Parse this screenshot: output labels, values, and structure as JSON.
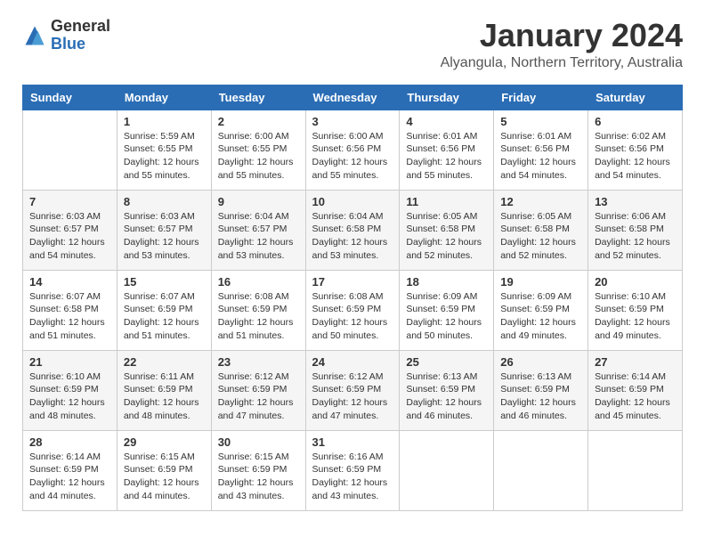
{
  "logo": {
    "general": "General",
    "blue": "Blue"
  },
  "header": {
    "month": "January 2024",
    "location": "Alyangula, Northern Territory, Australia"
  },
  "weekdays": [
    "Sunday",
    "Monday",
    "Tuesday",
    "Wednesday",
    "Thursday",
    "Friday",
    "Saturday"
  ],
  "weeks": [
    [
      {
        "day": "",
        "info": ""
      },
      {
        "day": "1",
        "info": "Sunrise: 5:59 AM\nSunset: 6:55 PM\nDaylight: 12 hours\nand 55 minutes."
      },
      {
        "day": "2",
        "info": "Sunrise: 6:00 AM\nSunset: 6:55 PM\nDaylight: 12 hours\nand 55 minutes."
      },
      {
        "day": "3",
        "info": "Sunrise: 6:00 AM\nSunset: 6:56 PM\nDaylight: 12 hours\nand 55 minutes."
      },
      {
        "day": "4",
        "info": "Sunrise: 6:01 AM\nSunset: 6:56 PM\nDaylight: 12 hours\nand 55 minutes."
      },
      {
        "day": "5",
        "info": "Sunrise: 6:01 AM\nSunset: 6:56 PM\nDaylight: 12 hours\nand 54 minutes."
      },
      {
        "day": "6",
        "info": "Sunrise: 6:02 AM\nSunset: 6:56 PM\nDaylight: 12 hours\nand 54 minutes."
      }
    ],
    [
      {
        "day": "7",
        "info": "Sunrise: 6:03 AM\nSunset: 6:57 PM\nDaylight: 12 hours\nand 54 minutes."
      },
      {
        "day": "8",
        "info": "Sunrise: 6:03 AM\nSunset: 6:57 PM\nDaylight: 12 hours\nand 53 minutes."
      },
      {
        "day": "9",
        "info": "Sunrise: 6:04 AM\nSunset: 6:57 PM\nDaylight: 12 hours\nand 53 minutes."
      },
      {
        "day": "10",
        "info": "Sunrise: 6:04 AM\nSunset: 6:58 PM\nDaylight: 12 hours\nand 53 minutes."
      },
      {
        "day": "11",
        "info": "Sunrise: 6:05 AM\nSunset: 6:58 PM\nDaylight: 12 hours\nand 52 minutes."
      },
      {
        "day": "12",
        "info": "Sunrise: 6:05 AM\nSunset: 6:58 PM\nDaylight: 12 hours\nand 52 minutes."
      },
      {
        "day": "13",
        "info": "Sunrise: 6:06 AM\nSunset: 6:58 PM\nDaylight: 12 hours\nand 52 minutes."
      }
    ],
    [
      {
        "day": "14",
        "info": "Sunrise: 6:07 AM\nSunset: 6:58 PM\nDaylight: 12 hours\nand 51 minutes."
      },
      {
        "day": "15",
        "info": "Sunrise: 6:07 AM\nSunset: 6:59 PM\nDaylight: 12 hours\nand 51 minutes."
      },
      {
        "day": "16",
        "info": "Sunrise: 6:08 AM\nSunset: 6:59 PM\nDaylight: 12 hours\nand 51 minutes."
      },
      {
        "day": "17",
        "info": "Sunrise: 6:08 AM\nSunset: 6:59 PM\nDaylight: 12 hours\nand 50 minutes."
      },
      {
        "day": "18",
        "info": "Sunrise: 6:09 AM\nSunset: 6:59 PM\nDaylight: 12 hours\nand 50 minutes."
      },
      {
        "day": "19",
        "info": "Sunrise: 6:09 AM\nSunset: 6:59 PM\nDaylight: 12 hours\nand 49 minutes."
      },
      {
        "day": "20",
        "info": "Sunrise: 6:10 AM\nSunset: 6:59 PM\nDaylight: 12 hours\nand 49 minutes."
      }
    ],
    [
      {
        "day": "21",
        "info": "Sunrise: 6:10 AM\nSunset: 6:59 PM\nDaylight: 12 hours\nand 48 minutes."
      },
      {
        "day": "22",
        "info": "Sunrise: 6:11 AM\nSunset: 6:59 PM\nDaylight: 12 hours\nand 48 minutes."
      },
      {
        "day": "23",
        "info": "Sunrise: 6:12 AM\nSunset: 6:59 PM\nDaylight: 12 hours\nand 47 minutes."
      },
      {
        "day": "24",
        "info": "Sunrise: 6:12 AM\nSunset: 6:59 PM\nDaylight: 12 hours\nand 47 minutes."
      },
      {
        "day": "25",
        "info": "Sunrise: 6:13 AM\nSunset: 6:59 PM\nDaylight: 12 hours\nand 46 minutes."
      },
      {
        "day": "26",
        "info": "Sunrise: 6:13 AM\nSunset: 6:59 PM\nDaylight: 12 hours\nand 46 minutes."
      },
      {
        "day": "27",
        "info": "Sunrise: 6:14 AM\nSunset: 6:59 PM\nDaylight: 12 hours\nand 45 minutes."
      }
    ],
    [
      {
        "day": "28",
        "info": "Sunrise: 6:14 AM\nSunset: 6:59 PM\nDaylight: 12 hours\nand 44 minutes."
      },
      {
        "day": "29",
        "info": "Sunrise: 6:15 AM\nSunset: 6:59 PM\nDaylight: 12 hours\nand 44 minutes."
      },
      {
        "day": "30",
        "info": "Sunrise: 6:15 AM\nSunset: 6:59 PM\nDaylight: 12 hours\nand 43 minutes."
      },
      {
        "day": "31",
        "info": "Sunrise: 6:16 AM\nSunset: 6:59 PM\nDaylight: 12 hours\nand 43 minutes."
      },
      {
        "day": "",
        "info": ""
      },
      {
        "day": "",
        "info": ""
      },
      {
        "day": "",
        "info": ""
      }
    ]
  ]
}
